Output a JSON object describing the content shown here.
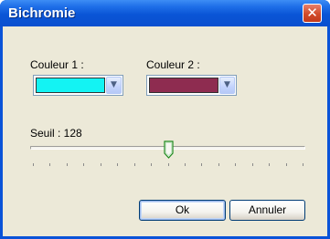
{
  "window": {
    "title": "Bichromie",
    "close_glyph": "✕"
  },
  "colors": {
    "color1": {
      "label": "Couleur 1 :",
      "swatch": "#13f3f3"
    },
    "color2": {
      "label": "Couleur 2 :",
      "swatch": "#8e2c50"
    },
    "dropdown_glyph": "▼"
  },
  "threshold": {
    "label": "Seuil : 128",
    "value": 128,
    "min": 0,
    "max": 255,
    "tick_count": 17
  },
  "buttons": {
    "ok": "Ok",
    "cancel": "Annuler"
  },
  "icons": {
    "close": "close-icon",
    "dropdown": "chevron-down-icon",
    "slider_thumb": "slider-thumb"
  }
}
